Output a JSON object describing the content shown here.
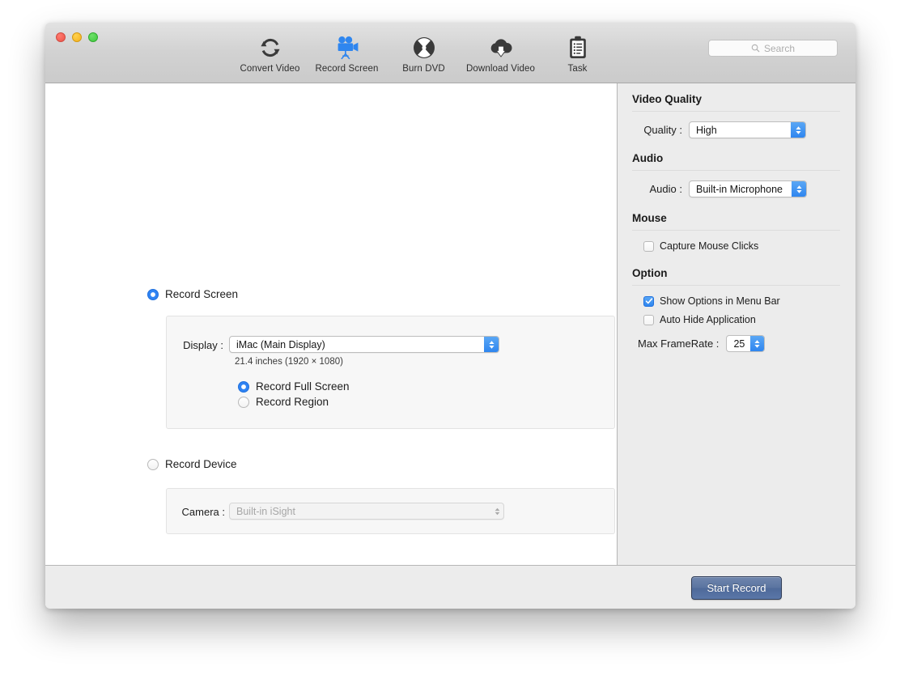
{
  "window": {
    "traffic_lights": [
      "close",
      "minimize",
      "zoom"
    ],
    "accent_blue": "#2f86ef",
    "button_blue": "#5a74a0"
  },
  "toolbar": {
    "items": [
      {
        "icon": "convert-video-icon",
        "label": "Convert Video",
        "selected": false
      },
      {
        "icon": "record-screen-icon",
        "label": "Record Screen",
        "selected": true
      },
      {
        "icon": "burn-dvd-icon",
        "label": "Burn DVD",
        "selected": false
      },
      {
        "icon": "download-video-icon",
        "label": "Download Video",
        "selected": false
      },
      {
        "icon": "task-icon",
        "label": "Task",
        "selected": false
      }
    ],
    "search": {
      "icon": "search-icon",
      "placeholder": "Search",
      "value": ""
    }
  },
  "main": {
    "record_screen": {
      "label": "Record Screen",
      "selected": true,
      "display_label": "Display :",
      "display_value": "iMac (Main Display)",
      "display_info": "21.4 inches (1920 × 1080)",
      "mode_options": [
        {
          "label": "Record Full Screen",
          "selected": true
        },
        {
          "label": "Record Region",
          "selected": false
        }
      ]
    },
    "record_device": {
      "label": "Record Device",
      "selected": false,
      "camera_label": "Camera :",
      "camera_value": "Built-in iSight",
      "disabled": true
    }
  },
  "sidebar": {
    "video_quality": {
      "heading": "Video Quality",
      "quality_label": "Quality :",
      "quality_value": "High"
    },
    "audio": {
      "heading": "Audio",
      "audio_label": "Audio :",
      "audio_value": "Built-in Microphone"
    },
    "mouse": {
      "heading": "Mouse",
      "capture_clicks_label": "Capture Mouse Clicks",
      "capture_clicks_checked": false
    },
    "option": {
      "heading": "Option",
      "show_options_label": "Show Options in Menu Bar",
      "show_options_checked": true,
      "auto_hide_label": "Auto Hide Application",
      "auto_hide_checked": false,
      "framerate_label": "Max FrameRate :",
      "framerate_value": "25"
    }
  },
  "footer": {
    "start_record_label": "Start Record"
  }
}
